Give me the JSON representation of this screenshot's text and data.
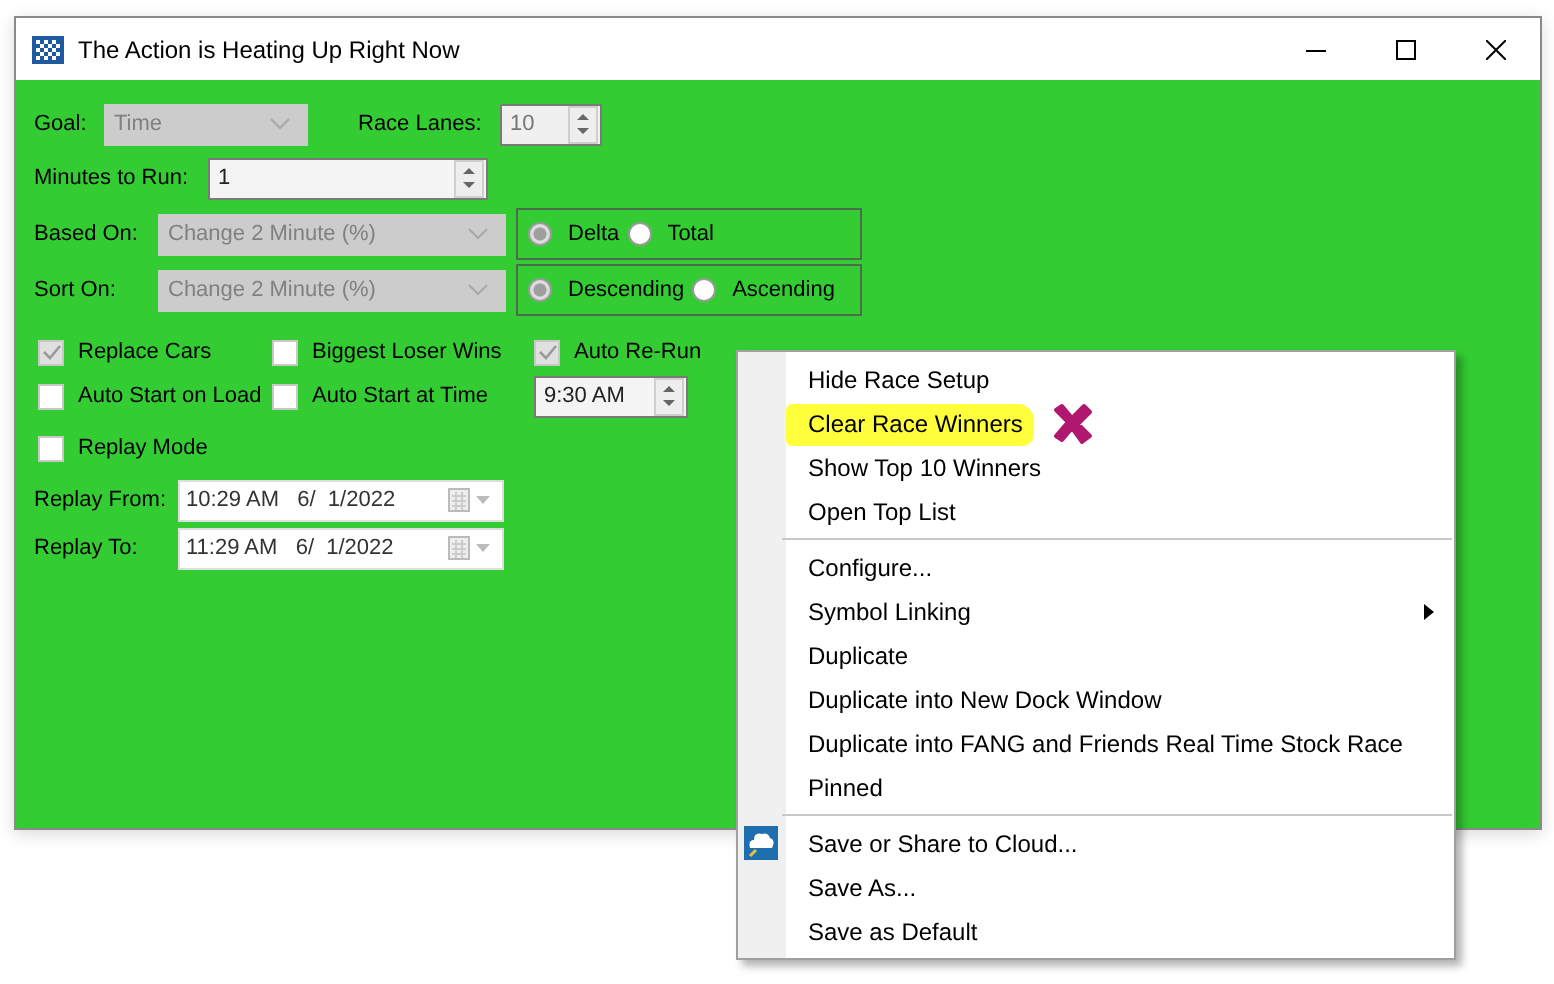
{
  "window": {
    "title": "The Action is Heating Up Right Now"
  },
  "setup": {
    "goal": {
      "label": "Goal:",
      "value": "Time",
      "disabled": true
    },
    "race_lanes": {
      "label": "Race Lanes:",
      "value": "10",
      "disabled": true
    },
    "minutes_to_run": {
      "label": "Minutes to Run:",
      "value": "1"
    },
    "based_on": {
      "label": "Based On:",
      "value": "Change 2 Minute (%)",
      "disabled": true,
      "options": [
        {
          "label": "Delta",
          "selected": true
        },
        {
          "label": "Total",
          "selected": false
        }
      ]
    },
    "sort_on": {
      "label": "Sort On:",
      "value": "Change 2 Minute (%)",
      "disabled": true,
      "options": [
        {
          "label": "Descending",
          "selected": true
        },
        {
          "label": "Ascending",
          "selected": false
        }
      ]
    },
    "checkboxes": [
      {
        "label": "Replace Cars",
        "checked": true
      },
      {
        "label": "Biggest Loser Wins",
        "checked": false
      },
      {
        "label": "Auto Re-Run",
        "checked": true
      },
      {
        "label": "Auto Start on Load",
        "checked": false
      },
      {
        "label": "Auto Start at Time",
        "checked": false
      }
    ],
    "start_time": {
      "value": "9:30 AM"
    },
    "replay_mode": {
      "label": "Replay Mode",
      "checked": false
    },
    "replay_from": {
      "label": "Replay From:",
      "value": "10:29 AM   6/  1/2022"
    },
    "replay_to": {
      "label": "Replay To:",
      "value": "11:29 AM   6/  1/2022"
    }
  },
  "context_menu": {
    "groups": [
      [
        {
          "label": "Hide Race Setup",
          "highlighted": false
        },
        {
          "label": "Clear Race Winners",
          "highlighted": true
        },
        {
          "label": "Show Top 10 Winners",
          "highlighted": false
        },
        {
          "label": "Open Top List",
          "highlighted": false
        }
      ],
      [
        {
          "label": "Configure...",
          "highlighted": false
        },
        {
          "label": "Symbol Linking",
          "highlighted": false,
          "submenu": true
        },
        {
          "label": "Duplicate",
          "highlighted": false
        },
        {
          "label": "Duplicate into New Dock Window",
          "highlighted": false
        },
        {
          "label": "Duplicate into FANG and Friends Real Time Stock Race",
          "highlighted": false
        },
        {
          "label": "Pinned",
          "highlighted": false
        }
      ],
      [
        {
          "label": "Save or Share to Cloud...",
          "highlighted": false
        },
        {
          "label": "Save As...",
          "highlighted": false
        },
        {
          "label": "Save as Default",
          "highlighted": false
        }
      ]
    ]
  }
}
